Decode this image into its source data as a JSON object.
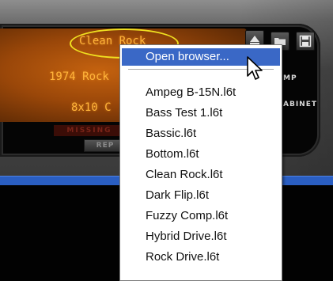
{
  "device": {
    "preset_name": "Clean Rock",
    "amp_name": "1974 Rock",
    "cab_name": "8x10 C",
    "missing_label": "MISSING",
    "rep_button_label": "REP",
    "amp_side_label": "MP",
    "cabinet_side_label": "ABINET"
  },
  "icons": {
    "up_arrow": "triangle-up-icon",
    "folder": "folder-icon",
    "save": "floppy-disk-icon",
    "cursor": "mouse-pointer-icon"
  },
  "menu": {
    "open_browser_label": "Open browser...",
    "items": [
      "Ampeg B-15N.l6t",
      "Bass Test 1.l6t",
      "Bassic.l6t",
      "Bottom.l6t",
      "Clean Rock.l6t",
      "Dark Flip.l6t",
      "Fuzzy Comp.l6t",
      "Hybrid Drive.l6t",
      "Rock Drive.l6t"
    ]
  },
  "colors": {
    "lcd_background": "#9a4709",
    "lcd_text": "#ffb43a",
    "highlight": "#3a68c6",
    "annotation_ellipse": "#f0e020",
    "lower_bar": "#2a5ec2"
  }
}
